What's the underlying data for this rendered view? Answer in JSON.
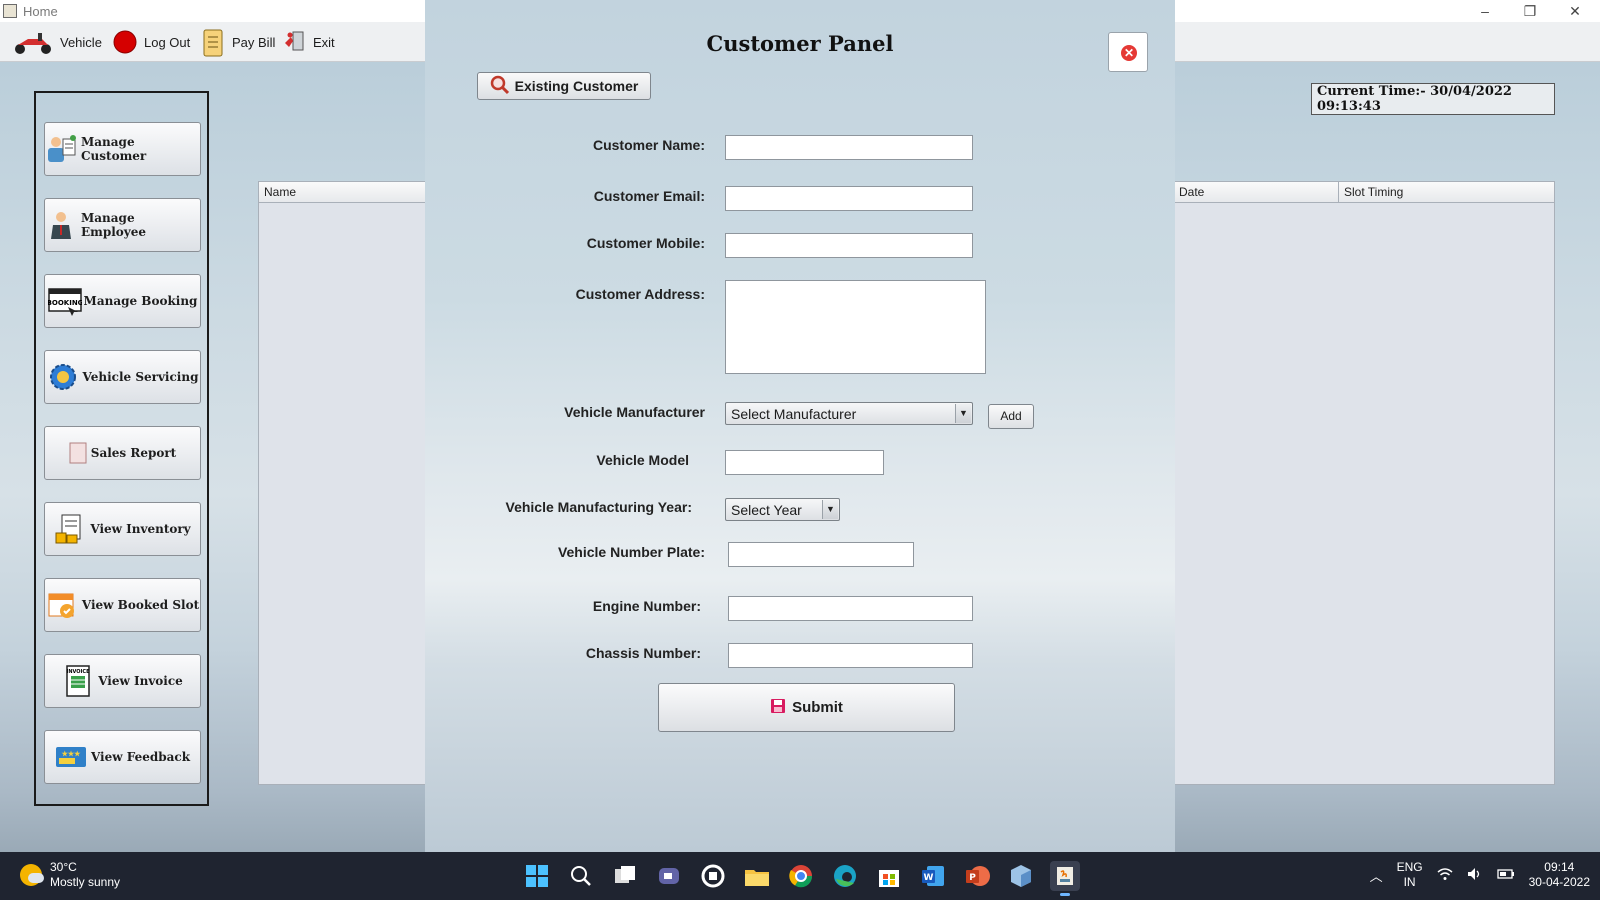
{
  "window": {
    "title": "Home"
  },
  "menu": {
    "vehicle": "Vehicle",
    "logout": "Log Out",
    "pay_bill": "Pay Bill",
    "exit": "Exit"
  },
  "sidebar": {
    "items": [
      {
        "label": "Manage Customer",
        "icon": "customer-icon"
      },
      {
        "label": "Manage Employee",
        "icon": "employee-icon"
      },
      {
        "label": "Manage Booking",
        "icon": "booking-icon"
      },
      {
        "label": "Vehicle Servicing",
        "icon": "gear-icon"
      },
      {
        "label": "Sales Report",
        "icon": "report-icon"
      },
      {
        "label": "View Inventory",
        "icon": "inventory-icon"
      },
      {
        "label": "View Booked Slot",
        "icon": "calendar-icon"
      },
      {
        "label": "View Invoice",
        "icon": "invoice-icon"
      },
      {
        "label": "View Feedback",
        "icon": "feedback-icon"
      }
    ]
  },
  "current_time": "Current Time:- 30/04/2022 09:13:43",
  "table": {
    "columns": [
      "Name",
      "Date",
      "Slot Timing"
    ]
  },
  "panel": {
    "title": "Customer Panel",
    "existing_customer": "Existing Customer",
    "labels": {
      "name": "Customer Name:",
      "email": "Customer Email:",
      "mobile": "Customer Mobile:",
      "address": "Customer Address:",
      "manufacturer": "Vehicle Manufacturer",
      "model": "Vehicle Model",
      "year": "Vehicle Manufacturing Year:",
      "plate": "Vehicle Number Plate:",
      "engine": "Engine Number:",
      "chassis": "Chassis Number:"
    },
    "values": {
      "name": "",
      "email": "",
      "mobile": "",
      "address": "",
      "model": "",
      "plate": "",
      "engine": "",
      "chassis": ""
    },
    "manufacturer_selected": "Select Manufacturer",
    "year_selected": "Select Year",
    "add": "Add",
    "submit": "Submit"
  },
  "taskbar": {
    "temperature": "30°C",
    "weather": "Mostly sunny",
    "lang_1": "ENG",
    "lang_2": "IN",
    "time": "09:14",
    "date": "30-04-2022"
  }
}
